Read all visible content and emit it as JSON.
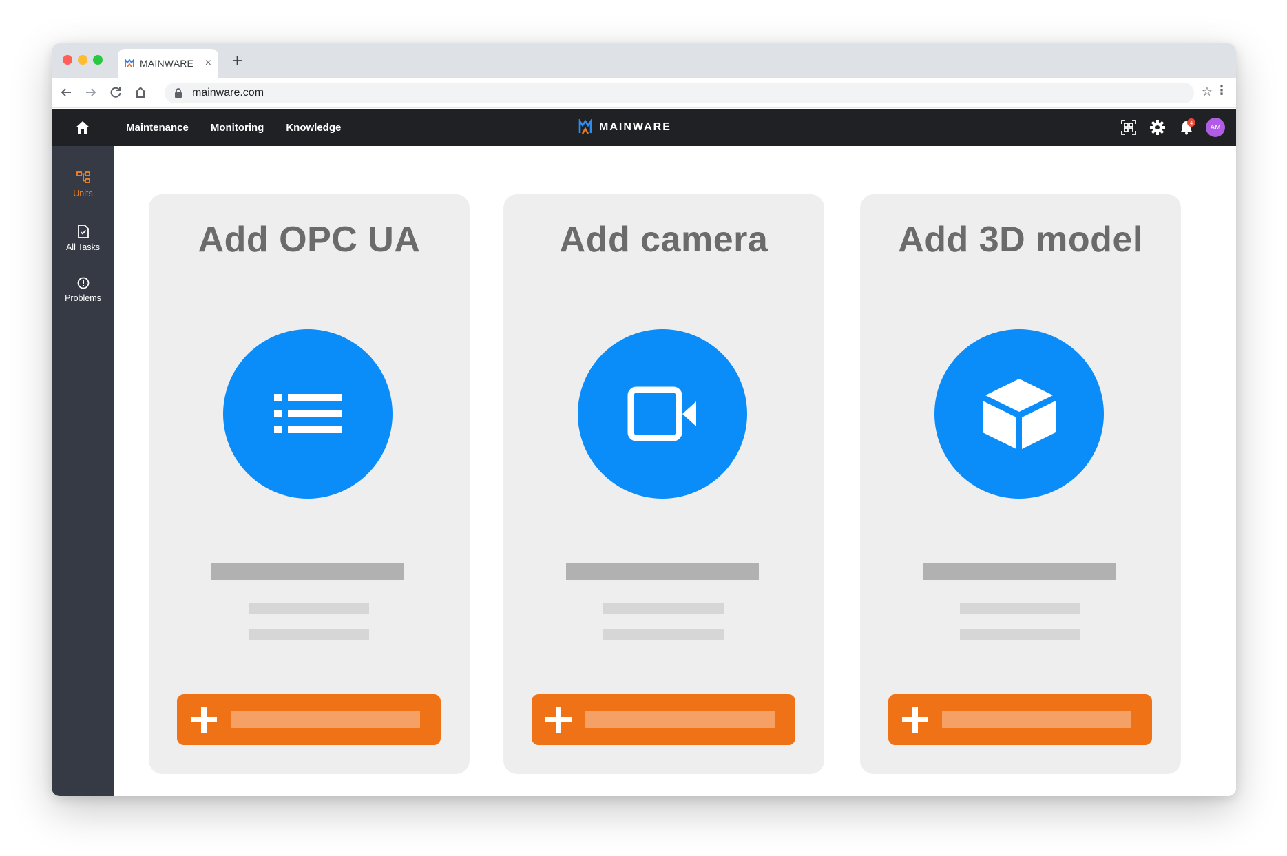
{
  "browser": {
    "tab_title": "MAINWARE",
    "tab_close": "×",
    "new_tab": "+",
    "url": "mainware.com",
    "icons": [
      "back-icon",
      "forward-icon",
      "reload-icon",
      "home-icon",
      "lock-icon",
      "star-icon",
      "kebab-icon"
    ]
  },
  "header": {
    "nav": [
      "Maintenance",
      "Monitoring",
      "Knowledge"
    ],
    "brand": "MAINWARE",
    "notification_count": "4",
    "avatar_initials": "AM",
    "icons": [
      "qr-scan-icon",
      "gear-icon",
      "bell-icon"
    ]
  },
  "sidebar": {
    "items": [
      {
        "label": "Units",
        "icon": "units-icon",
        "active": true
      },
      {
        "label": "All Tasks",
        "icon": "tasks-icon",
        "active": false
      },
      {
        "label": "Problems",
        "icon": "problems-icon",
        "active": false
      }
    ]
  },
  "cards": [
    {
      "title": "Add OPC UA",
      "icon": "list-icon"
    },
    {
      "title": "Add camera",
      "icon": "video-camera-icon"
    },
    {
      "title": "Add 3D model",
      "icon": "cube-icon"
    }
  ],
  "colors": {
    "accent_orange": "#ef7217",
    "icon_blue": "#0a8cf9",
    "header_dark": "#1f2125",
    "sidebar_dark": "#363a44",
    "card_bg": "#eeeeee"
  }
}
